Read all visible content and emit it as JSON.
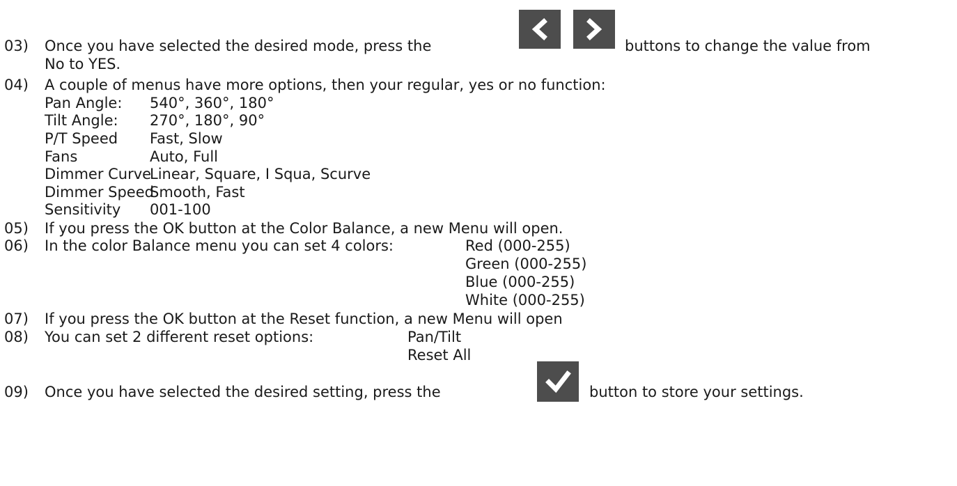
{
  "step03": {
    "num": "03)",
    "text_before": "Once you have selected the desired mode, press the",
    "text_after": "buttons to change the value from",
    "line2": "No to YES.",
    "left_button_icon": "chevron-left-icon",
    "right_button_icon": "chevron-right-icon"
  },
  "step04": {
    "num": "04)",
    "text": "A couple of menus have more options, then your regular, yes or no function:",
    "options": [
      {
        "name": "Pan Angle:",
        "values": "540°, 360°, 180°"
      },
      {
        "name": "Tilt Angle:",
        "values": "270°, 180°, 90°"
      },
      {
        "name": "P/T Speed",
        "values": "Fast, Slow"
      },
      {
        "name": "Fans",
        "values": "Auto, Full"
      },
      {
        "name": "Dimmer Curve",
        "values": "Linear, Square, I Squa, Scurve"
      },
      {
        "name": "Dimmer Speed",
        "values": "Smooth, Fast"
      },
      {
        "name": "Sensitivity",
        "values": "001-100"
      }
    ]
  },
  "step05": {
    "num": "05)",
    "text": "If you press the OK button at the Color Balance, a new Menu will open."
  },
  "step06": {
    "num": "06)",
    "text": "In the color Balance menu you can set 4 colors:",
    "colors": [
      "Red (000-255)",
      "Green (000-255)",
      "Blue (000-255)",
      "White (000-255)"
    ]
  },
  "step07": {
    "num": "07)",
    "text": "If you press the OK button at the Reset function, a new Menu will open"
  },
  "step08": {
    "num": "08)",
    "text": "You can set 2 different reset options:",
    "options": [
      "Pan/Tilt",
      "Reset All"
    ]
  },
  "step09": {
    "num": "09)",
    "text_before": "Once you have selected the desired setting, press the",
    "text_after": "button to store your settings.",
    "button_icon": "checkmark-icon"
  },
  "colors": {
    "text": "#1a1a1a",
    "button_bg": "#4d4d4d",
    "button_glyph": "#ffffff"
  }
}
